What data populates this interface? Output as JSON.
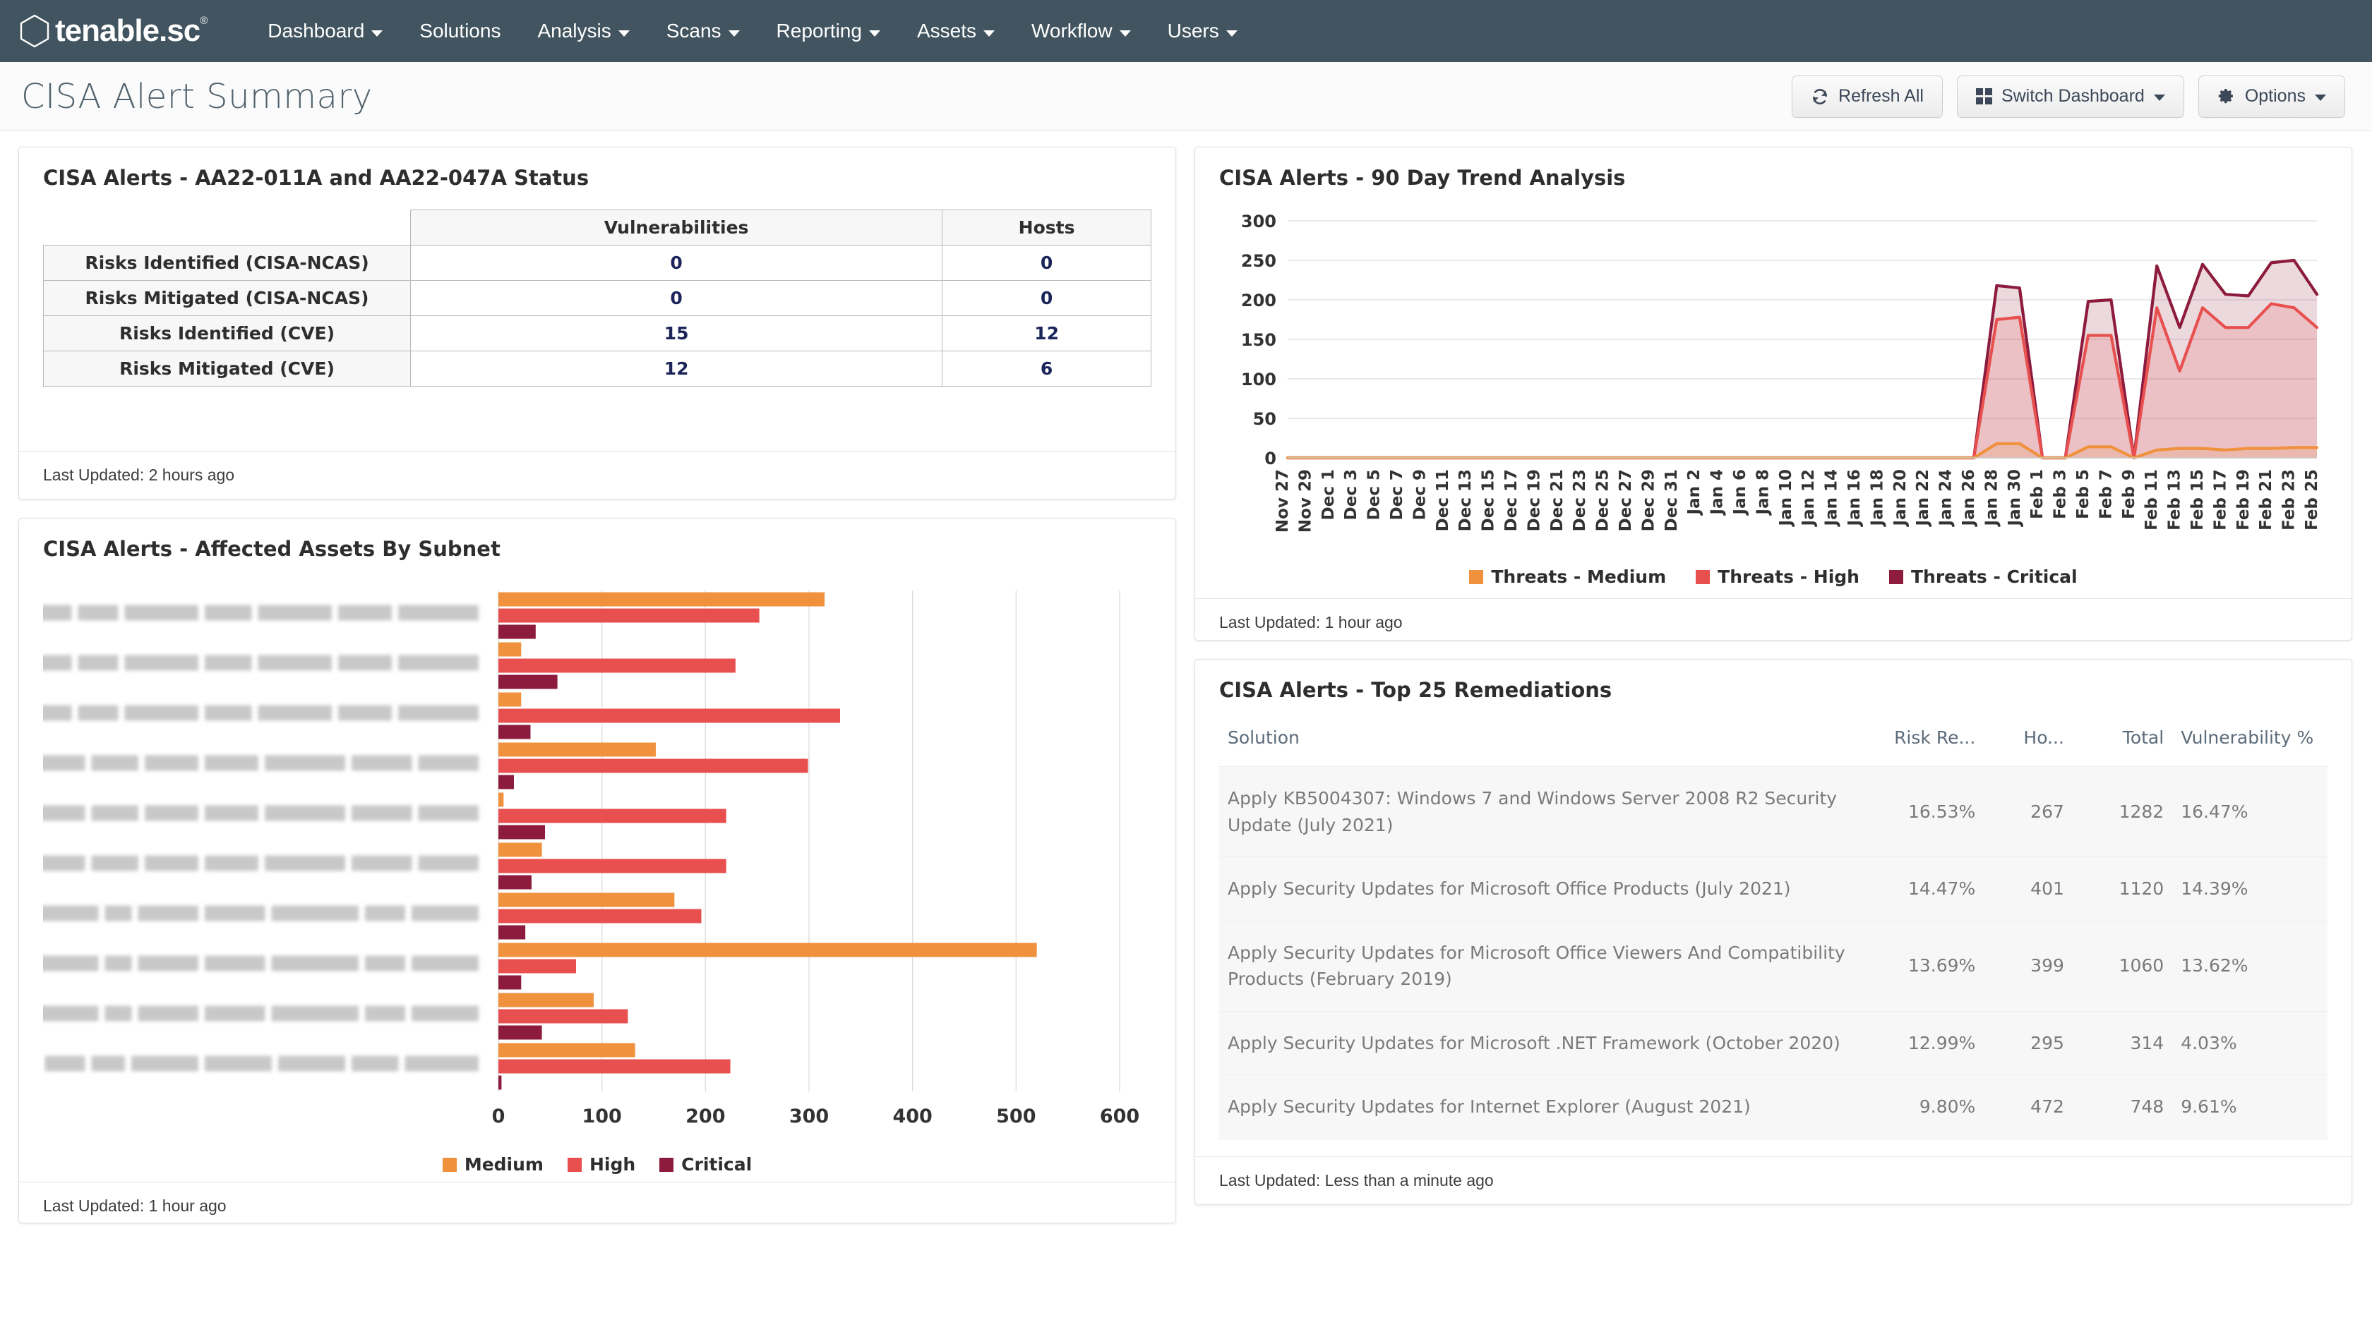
{
  "nav": {
    "brand": "tenable.sc",
    "brand_tm": "®",
    "items": [
      {
        "label": "Dashboard",
        "has_caret": true
      },
      {
        "label": "Solutions",
        "has_caret": false
      },
      {
        "label": "Analysis",
        "has_caret": true
      },
      {
        "label": "Scans",
        "has_caret": true
      },
      {
        "label": "Reporting",
        "has_caret": true
      },
      {
        "label": "Assets",
        "has_caret": true
      },
      {
        "label": "Workflow",
        "has_caret": true
      },
      {
        "label": "Users",
        "has_caret": true
      }
    ]
  },
  "header": {
    "title": "CISA Alert Summary",
    "refresh_label": "Refresh All",
    "switch_label": "Switch Dashboard",
    "options_label": "Options"
  },
  "colors": {
    "medium": "#F0913E",
    "high": "#E8504F",
    "critical": "#8D1B3D",
    "nav_bg": "#41545f",
    "value_navy": "#1b2559"
  },
  "status_panel": {
    "title": "CISA Alerts - AA22-011A and AA22-047A Status",
    "columns": [
      "",
      "Vulnerabilities",
      "Hosts"
    ],
    "rows": [
      {
        "label": "Risks Identified (CISA-NCAS)",
        "vulnerabilities": "0",
        "hosts": "0"
      },
      {
        "label": "Risks Mitigated (CISA-NCAS)",
        "vulnerabilities": "0",
        "hosts": "0"
      },
      {
        "label": "Risks Identified (CVE)",
        "vulnerabilities": "15",
        "hosts": "12"
      },
      {
        "label": "Risks Mitigated (CVE)",
        "vulnerabilities": "12",
        "hosts": "6"
      }
    ],
    "footer": "Last Updated: 2 hours ago"
  },
  "subnet_panel": {
    "title": "CISA Alerts - Affected Assets By Subnet",
    "footer": "Last Updated: 1 hour ago",
    "legend": [
      "Medium",
      "High",
      "Critical"
    ]
  },
  "trend_panel": {
    "title": "CISA Alerts - 90 Day Trend Analysis",
    "footer": "Last Updated: 1 hour ago",
    "legend": [
      "Threats - Medium",
      "Threats - High",
      "Threats - Critical"
    ]
  },
  "remediations_panel": {
    "title": "CISA Alerts - Top 25 Remediations",
    "columns": [
      "Solution",
      "Risk Re...",
      "Ho...",
      "Total",
      "Vulnerability %"
    ],
    "rows": [
      {
        "solution": "Apply KB5004307: Windows 7 and Windows Server 2008 R2 Security Update (July 2021)",
        "risk": "16.53%",
        "hosts": "267",
        "total": "1282",
        "vuln": "16.47%"
      },
      {
        "solution": "Apply Security Updates for Microsoft Office Products (July 2021)",
        "risk": "14.47%",
        "hosts": "401",
        "total": "1120",
        "vuln": "14.39%"
      },
      {
        "solution": "Apply Security Updates for Microsoft Office Viewers And Compatibility Products (February 2019)",
        "risk": "13.69%",
        "hosts": "399",
        "total": "1060",
        "vuln": "13.62%"
      },
      {
        "solution": "Apply Security Updates for Microsoft .NET Framework (October 2020)",
        "risk": "12.99%",
        "hosts": "295",
        "total": "314",
        "vuln": "4.03%"
      },
      {
        "solution": "Apply Security Updates for Internet Explorer (August 2021)",
        "risk": "9.80%",
        "hosts": "472",
        "total": "748",
        "vuln": "9.61%"
      }
    ],
    "footer": "Last Updated: Less than a minute ago"
  },
  "chart_data": [
    {
      "type": "area",
      "title": "CISA Alerts - 90 Day Trend Analysis",
      "xlabel": "",
      "ylabel": "",
      "ylim": [
        0,
        300
      ],
      "yticks": [
        0,
        50,
        100,
        150,
        200,
        250,
        300
      ],
      "grid": true,
      "legend_position": "bottom",
      "x": [
        "Nov 27",
        "Nov 29",
        "Dec 1",
        "Dec 3",
        "Dec 5",
        "Dec 7",
        "Dec 9",
        "Dec 11",
        "Dec 13",
        "Dec 15",
        "Dec 17",
        "Dec 19",
        "Dec 21",
        "Dec 23",
        "Dec 25",
        "Dec 27",
        "Dec 29",
        "Dec 31",
        "Jan 2",
        "Jan 4",
        "Jan 6",
        "Jan 8",
        "Jan 10",
        "Jan 12",
        "Jan 14",
        "Jan 16",
        "Jan 18",
        "Jan 20",
        "Jan 22",
        "Jan 24",
        "Jan 26",
        "Jan 28",
        "Jan 30",
        "Feb 1",
        "Feb 3",
        "Feb 5",
        "Feb 7",
        "Feb 9",
        "Feb 11",
        "Feb 13",
        "Feb 15",
        "Feb 17",
        "Feb 19",
        "Feb 21",
        "Feb 23",
        "Feb 25"
      ],
      "series": [
        {
          "name": "Threats - Medium",
          "color": "#F0913E",
          "values": [
            0,
            0,
            0,
            0,
            0,
            0,
            0,
            0,
            0,
            0,
            0,
            0,
            0,
            0,
            0,
            0,
            0,
            0,
            0,
            0,
            0,
            0,
            0,
            0,
            0,
            0,
            0,
            0,
            0,
            0,
            0,
            18,
            18,
            0,
            0,
            14,
            14,
            0,
            10,
            12,
            12,
            10,
            12,
            12,
            13,
            13
          ]
        },
        {
          "name": "Threats - High",
          "color": "#E8504F",
          "values": [
            0,
            0,
            0,
            0,
            0,
            0,
            0,
            0,
            0,
            0,
            0,
            0,
            0,
            0,
            0,
            0,
            0,
            0,
            0,
            0,
            0,
            0,
            0,
            0,
            0,
            0,
            0,
            0,
            0,
            0,
            0,
            175,
            178,
            0,
            0,
            155,
            155,
            0,
            190,
            110,
            190,
            165,
            165,
            195,
            190,
            165
          ]
        },
        {
          "name": "Threats - Critical",
          "color": "#8D1B3D",
          "values": [
            0,
            0,
            0,
            0,
            0,
            0,
            0,
            0,
            0,
            0,
            0,
            0,
            0,
            0,
            0,
            0,
            0,
            0,
            0,
            0,
            0,
            0,
            0,
            0,
            0,
            0,
            0,
            0,
            0,
            0,
            0,
            218,
            215,
            0,
            0,
            198,
            200,
            0,
            243,
            165,
            245,
            207,
            205,
            247,
            250,
            207
          ]
        }
      ]
    },
    {
      "type": "bar",
      "orientation": "horizontal",
      "title": "CISA Alerts - Affected Assets By Subnet",
      "xlim": [
        0,
        600
      ],
      "xticks": [
        0,
        100,
        200,
        300,
        400,
        500,
        600
      ],
      "grid": true,
      "legend_position": "bottom",
      "categories": [
        "subnet-1",
        "subnet-2",
        "subnet-3",
        "subnet-4",
        "subnet-5",
        "subnet-6",
        "subnet-7",
        "subnet-8",
        "subnet-9",
        "subnet-10"
      ],
      "categories_redacted": true,
      "series": [
        {
          "name": "Medium",
          "color": "#F0913E",
          "values": [
            315,
            22,
            22,
            152,
            5,
            42,
            170,
            520,
            92,
            132
          ]
        },
        {
          "name": "High",
          "color": "#E8504F",
          "values": [
            252,
            229,
            330,
            299,
            220,
            220,
            196,
            75,
            125,
            224
          ]
        },
        {
          "name": "Critical",
          "color": "#8D1B3D",
          "values": [
            36,
            57,
            31,
            15,
            45,
            32,
            26,
            22,
            42,
            3
          ]
        }
      ]
    }
  ]
}
